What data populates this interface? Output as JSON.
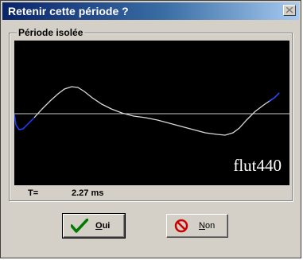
{
  "window": {
    "title": "Retenir cette période ?"
  },
  "group": {
    "label": "Période isolée"
  },
  "plot": {
    "label": "flut440",
    "colors": {
      "background": "#000000",
      "trace": "#d8d8d8",
      "axis": "#c8c8c8",
      "trace_edge": "#2040ff"
    }
  },
  "period": {
    "label": "T=",
    "value": "2.27 ms"
  },
  "buttons": {
    "oui": {
      "first": "O",
      "rest": "ui",
      "icon": "checkmark-icon"
    },
    "non": {
      "first": "N",
      "rest": "on",
      "icon": "forbidden-icon"
    }
  }
}
